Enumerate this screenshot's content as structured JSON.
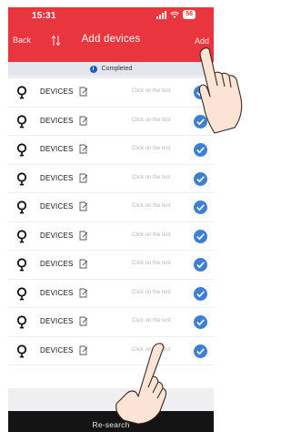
{
  "status_bar": {
    "time": "15:31",
    "battery": "56"
  },
  "header": {
    "back_label": "Back",
    "title": "Add devices",
    "add_label": "Add"
  },
  "banner": {
    "info_glyph": "i",
    "text": "Completed"
  },
  "devices": [
    {
      "name": "DEVICES",
      "hint": "Click on the test",
      "checked": true
    },
    {
      "name": "DEVICES",
      "hint": "Click on the test",
      "checked": true
    },
    {
      "name": "DEVICES",
      "hint": "Click on the test",
      "checked": true
    },
    {
      "name": "DEVICES",
      "hint": "Click on the test",
      "checked": true
    },
    {
      "name": "DEVICES",
      "hint": "Click on the test",
      "checked": true
    },
    {
      "name": "DEVICES",
      "hint": "Click on the test",
      "checked": true
    },
    {
      "name": "DEVICES",
      "hint": "Click on the test",
      "checked": true
    },
    {
      "name": "DEVICES",
      "hint": "Click on the test",
      "checked": true
    },
    {
      "name": "DEVICES",
      "hint": "Click on the test",
      "checked": true
    },
    {
      "name": "DEVICES",
      "hint": "Click on the test",
      "checked": true
    }
  ],
  "footer": {
    "research_label": "Re-search"
  },
  "colors": {
    "header": "#e8353e",
    "check": "#3d7fd1",
    "footer": "#141414"
  }
}
